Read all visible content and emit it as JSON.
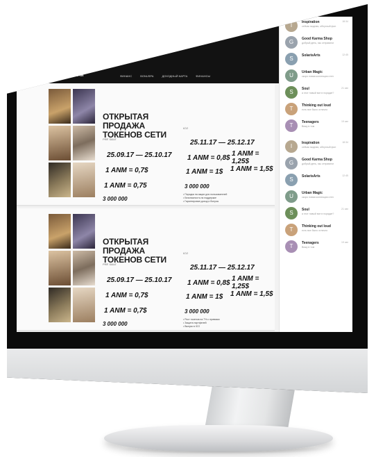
{
  "site": {
    "logo": "DONUM",
    "nav": [
      "ФИНАНС",
      "BONUSPA",
      "ДОХОДНЫЙ КАРТА",
      "ФИНАНСЫ"
    ]
  },
  "cards": [
    {
      "title": "ОТКРЫТАЯ ПРОДАЖА ТОКЕНОВ СЕТИ",
      "pre_sale": "PRE SALE",
      "ico": "ICO",
      "pre_dates": "25.09.17 — 25.10.17",
      "ico_dates": "25.11.17 — 25.12.17",
      "rate_a": "1 ANM = 0,7$",
      "rate_b": "1 ANM = 0,8$",
      "rate_c": "1 ANM = 1,25$",
      "rate_d": "1 ANM = 0,75",
      "rate_e": "1 ANM = 1$",
      "rate_f": "1 ANM = 1,5$",
      "supply_a": "3 000 000",
      "supply_b": "3 000 000"
    },
    {
      "title": "ОТКРЫТАЯ ПРОДАЖА ТОКЕНОВ СЕТИ",
      "pre_sale": "PRE SALE",
      "ico": "ICO",
      "pre_dates": "25.09.17 — 25.10.17",
      "ico_dates": "25.11.17 — 25.12.17",
      "rate_a": "1 ANM = 0,7$",
      "rate_b": "1 ANM = 0,8$",
      "rate_c": "1 ANM = 1,25$",
      "rate_d": "1 ANM = 0,7$",
      "rate_e": "1 ANM = 1$",
      "rate_f": "1 ANM = 1,5$",
      "supply_a": "3 000 000",
      "supply_b": "3 000 000"
    }
  ],
  "chat": [
    {
      "initial": "I",
      "name": "Inspiration",
      "msg": "сейчас модная, обнуглый фон",
      "time": "18:34",
      "color": "#b7a890"
    },
    {
      "initial": "G",
      "name": "Good Karma Shop",
      "msg": "добрый день, мы отправили",
      "time": "",
      "color": "#9aa3ad"
    },
    {
      "initial": "S",
      "name": "SolarisArts",
      "msg": "",
      "time": "12:45",
      "color": "#8aa0b0"
    },
    {
      "initial": "U",
      "name": "Urban Magic",
      "msg": "скоро новая коллекция стен",
      "time": "",
      "color": "#7f9c8a"
    },
    {
      "initial": "S",
      "name": "Soul",
      "msg": "а этот новый все в порядке?",
      "time": "21 авг",
      "color": "#6d8f5a"
    },
    {
      "initial": "T",
      "name": "Thinking out loud",
      "msg": "есть все было отлично",
      "time": "",
      "color": "#c9a27a"
    },
    {
      "initial": "T",
      "name": "Teenagers",
      "msg": "Вижу в том",
      "time": "19 авг",
      "color": "#a88fb4"
    },
    {
      "initial": "I",
      "name": "Inspiration",
      "msg": "сейчас модная, обнуглый фон",
      "time": "18:34",
      "color": "#b7a890"
    },
    {
      "initial": "G",
      "name": "Good Karma Shop",
      "msg": "добрый день, мы отправили",
      "time": "",
      "color": "#9aa3ad"
    },
    {
      "initial": "S",
      "name": "SolarisArts",
      "msg": "",
      "time": "12:45",
      "color": "#8aa0b0"
    },
    {
      "initial": "U",
      "name": "Urban Magic",
      "msg": "скоро новая коллекция стен",
      "time": "",
      "color": "#7f9c8a"
    },
    {
      "initial": "S",
      "name": "Soul",
      "msg": "а этот новый все в порядке?",
      "time": "21 авг",
      "color": "#6d8f5a"
    },
    {
      "initial": "T",
      "name": "Thinking out loud",
      "msg": "есть все было отлично",
      "time": "",
      "color": "#c9a27a"
    },
    {
      "initial": "T",
      "name": "Teenagers",
      "msg": "Вижу в том",
      "time": "19 авг",
      "color": "#a88fb4"
    }
  ],
  "bullets": [
    "Порядок на акции для пользователей",
    "Безопасность на поддержке",
    "Гарантирован доход и бонусы",
    "Рост токенов на 7% с привязки",
    "Защита портфелей",
    "Выпуск в ICO"
  ]
}
